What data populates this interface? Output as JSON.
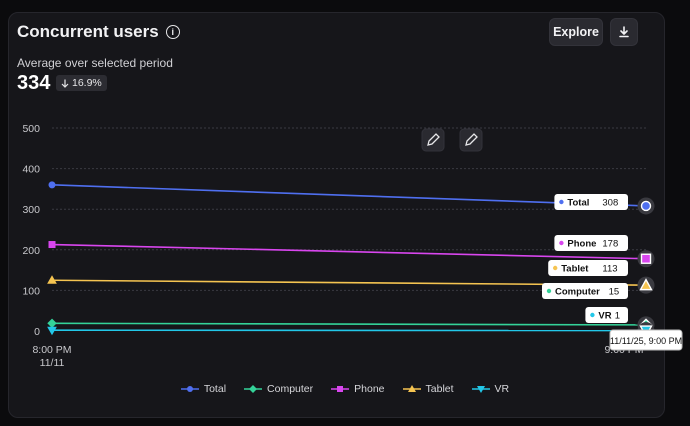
{
  "card": {
    "title": "Concurrent users",
    "explore_label": "Explore",
    "subtitle": "Average over selected period",
    "average_value": "334",
    "delta": "16.9%"
  },
  "icons": {
    "info": "info-icon",
    "download": "download-icon",
    "edit": "pencil-icon",
    "delta": "arrow-down-icon"
  },
  "tooltip": {
    "text": "11/11/25, 9:00 PM"
  },
  "chart_data": {
    "type": "line",
    "x": [
      "8:00 PM 11/11",
      "9:00 PM 11/11"
    ],
    "x_tick_labels": [
      {
        "line1": "8:00 PM",
        "line2": "11/11"
      },
      {
        "line1": "9:00 PM",
        "line2": ""
      }
    ],
    "ylim": [
      0,
      500
    ],
    "y_ticks": [
      0,
      100,
      200,
      300,
      400,
      500
    ],
    "grid": true,
    "legend_position": "bottom-center",
    "series": [
      {
        "name": "Total",
        "color": "#4f6ff0",
        "marker": "circle",
        "values": [
          360,
          308
        ]
      },
      {
        "name": "Computer",
        "color": "#34d399",
        "marker": "diamond",
        "values": [
          19,
          15
        ]
      },
      {
        "name": "Phone",
        "color": "#d946ef",
        "marker": "square",
        "values": [
          213,
          178
        ]
      },
      {
        "name": "Tablet",
        "color": "#f5c451",
        "marker": "triangle",
        "values": [
          125,
          113
        ]
      },
      {
        "name": "VR",
        "color": "#22c7e8",
        "marker": "triangle-down",
        "values": [
          2,
          1
        ]
      }
    ],
    "end_labels": [
      {
        "name": "Total",
        "value": "308"
      },
      {
        "name": "Phone",
        "value": "178"
      },
      {
        "name": "Tablet",
        "value": "113"
      },
      {
        "name": "Computer",
        "value": "15"
      },
      {
        "name": "VR",
        "value": "1"
      }
    ]
  }
}
